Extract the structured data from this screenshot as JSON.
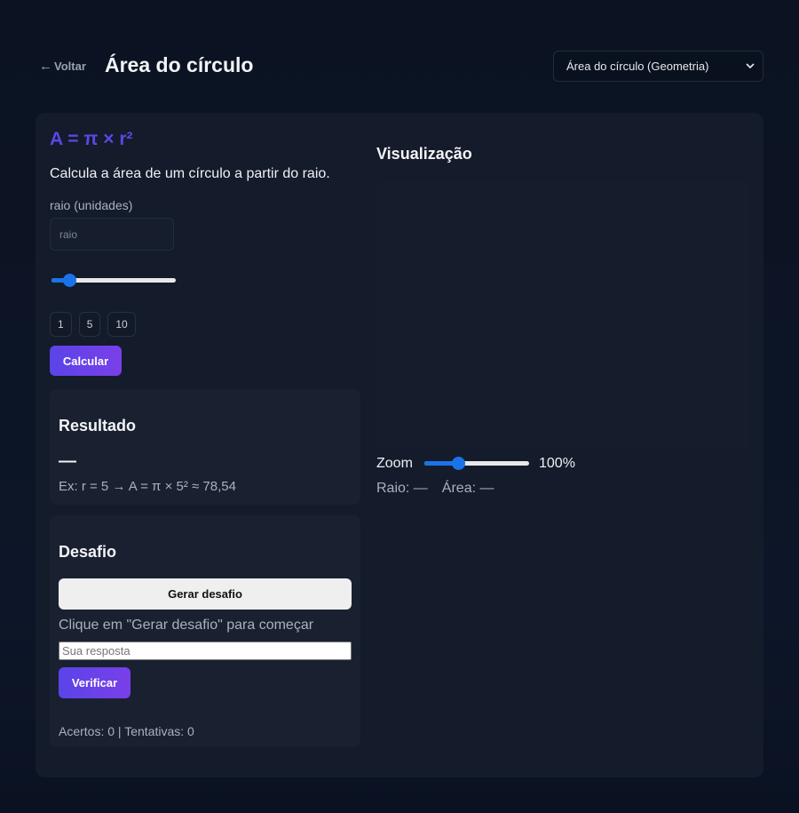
{
  "header": {
    "back_label": "Voltar",
    "title": "Área do círculo",
    "topic_select": {
      "value": "Área do círculo (Geometria)"
    }
  },
  "calculator": {
    "formula": "A = π × r²",
    "description": "Calcula a área de um círculo a partir do raio.",
    "field_label": "raio (unidades)",
    "input_placeholder": "raio",
    "slider_value_fraction": 0.1,
    "presets": [
      "1",
      "5",
      "10"
    ],
    "calculate_label": "Calcular"
  },
  "result": {
    "title": "Resultado",
    "value": "—",
    "example": "Ex: r = 5 → A = π × 5² ≈ 78,54"
  },
  "challenge": {
    "title": "Desafio",
    "generate_label": "Gerar desafio",
    "prompt": "Clique em \"Gerar desafio\" para começar",
    "answer_placeholder": "Sua resposta",
    "verify_label": "Verificar",
    "score": "Acertos: 0 | Tentativas: 0"
  },
  "visualization": {
    "title": "Visualização",
    "zoom_label": "Zoom",
    "zoom_value": "100%",
    "zoom_slider_fraction": 0.3,
    "radius_stat": "Raio: —",
    "area_stat": "Área: —"
  },
  "colors": {
    "accent": "#5a48e6",
    "slider": "#1a73e8",
    "background": "#0b1322",
    "card": "#141b2a"
  }
}
